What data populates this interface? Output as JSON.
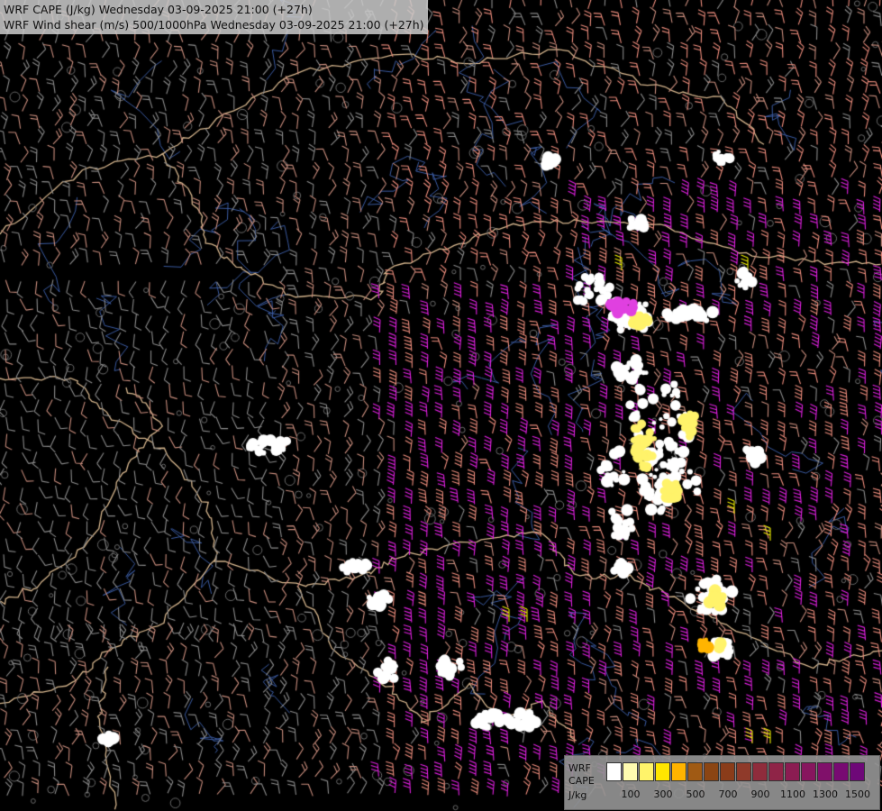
{
  "titles": {
    "line1": "WRF CAPE (J/kg) Wednesday 03-09-2025 21:00 (+27h)",
    "line2": "WRF Wind shear (m/s) 500/1000hPa Wednesday 03-09-2025 21:00 (+27h)"
  },
  "legend": {
    "label_line1": "WRF",
    "label_line2": "CAPE",
    "label_line3": "J/kg",
    "colors": [
      "#ffffff",
      "#fffbb0",
      "#fff36a",
      "#ffe600",
      "#ffb400",
      "#a05a14",
      "#8b4513",
      "#8a3c1a",
      "#8f3a2a",
      "#8f2c3c",
      "#8f2447",
      "#8b1c52",
      "#87165e",
      "#80106a",
      "#780a72",
      "#6e0878"
    ],
    "ticks": [
      {
        "label": "100",
        "index": 1
      },
      {
        "label": "300",
        "index": 3
      },
      {
        "label": "500",
        "index": 5
      },
      {
        "label": "700",
        "index": 7
      },
      {
        "label": "900",
        "index": 9
      },
      {
        "label": "1100",
        "index": 11
      },
      {
        "label": "1300",
        "index": 13
      },
      {
        "label": "1500",
        "index": 15
      }
    ]
  },
  "map_colors": {
    "background": "#000000",
    "barb_gray": "#8a8a8a",
    "barb_tan": "#c88c7c",
    "barb_salmon": "#ec8c7c",
    "barb_magenta": "#e020e0",
    "barb_yellow": "#f0f000",
    "border": "#d4b48c",
    "river": "#3a5aa0",
    "cape_white": "#ffffff",
    "cape_yellow": "#fff36a"
  }
}
